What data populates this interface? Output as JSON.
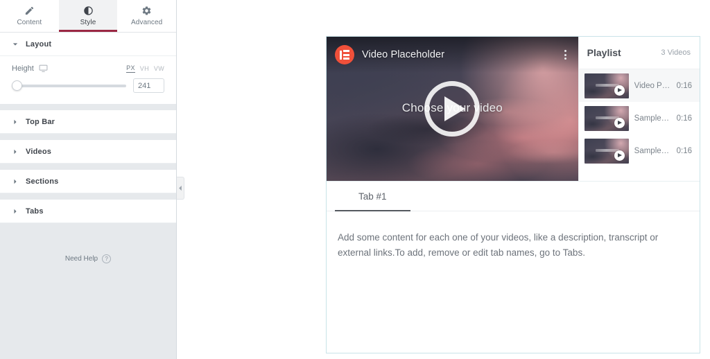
{
  "panel": {
    "tabs": [
      {
        "label": "Content",
        "icon": "pencil-icon",
        "active": false
      },
      {
        "label": "Style",
        "icon": "contrast-circle-icon",
        "active": true
      },
      {
        "label": "Advanced",
        "icon": "gear-icon",
        "active": false
      }
    ],
    "accent_color": "#9b2743",
    "sections": [
      {
        "label": "Layout",
        "open": true
      },
      {
        "label": "Top Bar",
        "open": false
      },
      {
        "label": "Videos",
        "open": false
      },
      {
        "label": "Sections",
        "open": false
      },
      {
        "label": "Tabs",
        "open": false
      }
    ],
    "layout_controls": {
      "height_label": "Height",
      "device_icon": "desktop-icon",
      "units": [
        {
          "label": "PX",
          "active": true
        },
        {
          "label": "VH",
          "active": false
        },
        {
          "label": "VW",
          "active": false
        }
      ],
      "height_value": "241",
      "slider_position_percent": 0
    },
    "need_help": {
      "label": "Need Help",
      "icon_glyph": "?"
    },
    "collapse_handle_icon": "chevron-left-icon"
  },
  "widget": {
    "border_color": "#c9e3e8",
    "video": {
      "brand_icon": "elementor-logo-icon",
      "brand_color": "#f0503a",
      "title": "Video Placeholder",
      "menu_icon": "kebab-menu-icon",
      "caption": "Choose your video",
      "play_icon": "play-button-icon"
    },
    "playlist": {
      "title": "Playlist",
      "count_label": "3 Videos",
      "items": [
        {
          "name": "Video P…",
          "duration": "0:16",
          "active": true,
          "thumb_icon": "video-thumbnail"
        },
        {
          "name": "Sample…",
          "duration": "0:16",
          "active": false,
          "thumb_icon": "video-thumbnail"
        },
        {
          "name": "Sample…",
          "duration": "0:16",
          "active": false,
          "thumb_icon": "video-thumbnail"
        }
      ]
    },
    "tabs": [
      {
        "label": "Tab #1",
        "active": true
      }
    ],
    "tab_content": {
      "text": "Add some content for each one of your videos, like a description, transcript or external links.To add, remove or edit tab names, go to Tabs."
    }
  }
}
